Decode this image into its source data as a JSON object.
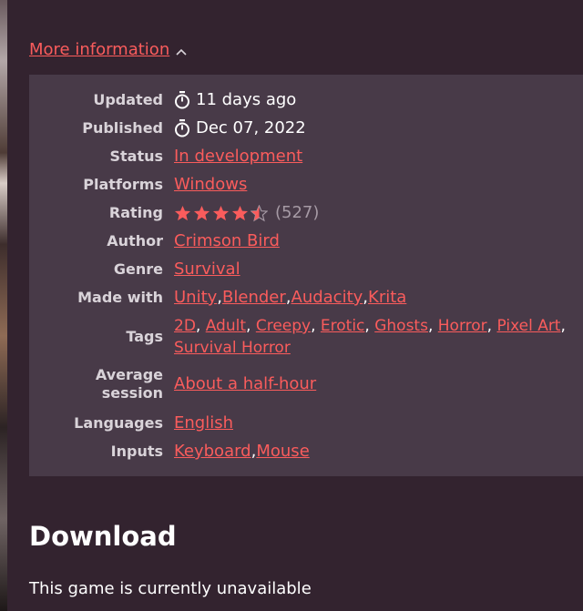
{
  "more_info": {
    "label": "More information"
  },
  "updated": {
    "label": "Updated",
    "value": "11 days ago"
  },
  "published": {
    "label": "Published",
    "value": "Dec 07, 2022"
  },
  "status": {
    "label": "Status",
    "value": "In development"
  },
  "platforms": {
    "label": "Platforms",
    "value": "Windows"
  },
  "rating": {
    "label": "Rating",
    "stars": 4.5,
    "count": "(527)"
  },
  "author": {
    "label": "Author",
    "value": "Crimson Bird"
  },
  "genre": {
    "label": "Genre",
    "value": "Survival"
  },
  "made_with": {
    "label": "Made with",
    "items": [
      "Unity",
      "Blender",
      "Audacity",
      "Krita"
    ]
  },
  "tags": {
    "label": "Tags",
    "items": [
      "2D",
      "Adult",
      "Creepy",
      "Erotic",
      "Ghosts",
      "Horror",
      "Pixel Art",
      "Survival Horror"
    ]
  },
  "average_session": {
    "label_line1": "Average",
    "label_line2": "session",
    "value": "About a half-hour"
  },
  "languages": {
    "label": "Languages",
    "value": "English"
  },
  "inputs": {
    "label": "Inputs",
    "items": [
      "Keyboard",
      "Mouse"
    ]
  },
  "download": {
    "title": "Download",
    "message": "This game is currently unavailable"
  },
  "colors": {
    "link": "#fa5c5c",
    "panel": "#483a48",
    "background": "#33232f",
    "star": "#fa5c5c"
  },
  "icons": {
    "clock": "stopwatch-icon",
    "chevron": "chevron-up-icon",
    "star": "star-icon"
  }
}
